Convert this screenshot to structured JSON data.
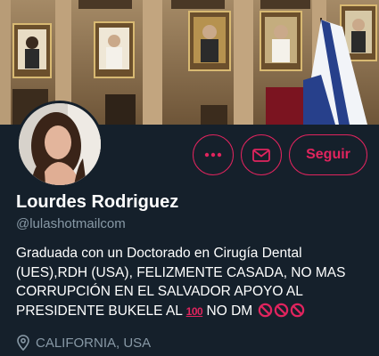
{
  "profile": {
    "display_name": "Lourdes Rodriguez",
    "handle": "@lulashotmailcom",
    "bio_lines": [
      "Graduada con un Doctorado en Cirugía Dental",
      "(UES),RDH (USA), FELIZMENTE CASADA, NO MAS",
      "CORRUPCIÓN EN EL SALVADOR APOYO AL",
      "PRESIDENTE BUKELE AL"
    ],
    "bio_emoji_100": "100",
    "bio_after_emoji": "NO DM",
    "location": "CALIFORNIA, USA"
  },
  "actions": {
    "more_icon": "more-icon",
    "message_icon": "envelope-icon",
    "follow_label": "Seguir"
  },
  "colors": {
    "background": "#15202b",
    "accent": "#e0245e",
    "secondary_text": "#8899a6"
  },
  "banner": {
    "icon": "banner-image"
  },
  "avatar": {
    "icon": "avatar-image"
  }
}
